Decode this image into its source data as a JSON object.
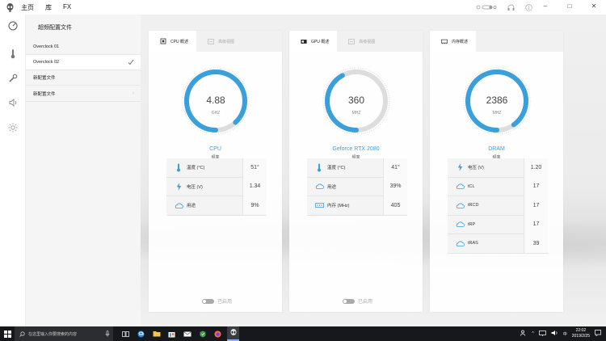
{
  "titlebar": {
    "nav": [
      "主页",
      "库",
      "FX"
    ],
    "tools": [
      "display-toggle-icon",
      "headset-icon",
      "info-icon"
    ],
    "window_controls": [
      "minimize",
      "maximize",
      "close"
    ]
  },
  "rail": {
    "items": [
      "overclock-icon",
      "thermometer-icon",
      "wrench-icon",
      "speaker-icon",
      "brightness-icon"
    ]
  },
  "profiles": {
    "title": "超频配置文件",
    "items": [
      {
        "label": "Overclock 01",
        "selected": false
      },
      {
        "label": "Overclock 02",
        "selected": true
      },
      {
        "label": "新配置文件",
        "selected": false
      },
      {
        "label": "新配置文件",
        "selected": false,
        "has_chevron": true
      }
    ]
  },
  "cards": [
    {
      "tabs": [
        "CPU 概述",
        "高级视图"
      ],
      "tab_icons": [
        "cpu-chip-icon",
        "advanced-view-icon"
      ],
      "gauge": {
        "value": "4.88",
        "unit": "GHZ",
        "fill": 0.88
      },
      "name": "CPU",
      "sub": "频率",
      "stats": [
        {
          "icon": "thermometer-icon",
          "label": "温度 (°C)",
          "value": "51°"
        },
        {
          "icon": "lightning-icon",
          "label": "电压 (V)",
          "value": "1.34"
        },
        {
          "icon": "cloud-icon",
          "label": "用途",
          "value": "9%"
        }
      ],
      "toggle_label": "已启用"
    },
    {
      "tabs": [
        "GPU 概述",
        "高级视图"
      ],
      "tab_icons": [
        "gpu-card-icon",
        "advanced-view-icon"
      ],
      "gauge": {
        "value": "360",
        "unit": "MHZ",
        "fill": 0.42
      },
      "name": "Geforce RTX 2080",
      "sub": "频率",
      "stats": [
        {
          "icon": "thermometer-icon",
          "label": "温度 (°C)",
          "value": "41°"
        },
        {
          "icon": "cloud-icon",
          "label": "用途",
          "value": "39%"
        },
        {
          "icon": "memory-icon",
          "label": "内存 (MHz)",
          "value": "405"
        }
      ],
      "toggle_label": "已启用"
    },
    {
      "tabs": [
        "内存概述"
      ],
      "tab_icons": [
        "memory-module-icon"
      ],
      "gauge": {
        "value": "2386",
        "unit": "MHZ",
        "fill": 0.9
      },
      "name": "DRAM",
      "sub": "频率",
      "stats": [
        {
          "icon": "lightning-icon",
          "label": "电压 (V)",
          "value": "1.20"
        },
        {
          "icon": "cloud-icon",
          "label": "tCL",
          "value": "17"
        },
        {
          "icon": "cloud-icon",
          "label": "tRCD",
          "value": "17"
        },
        {
          "icon": "cloud-icon",
          "label": "tRP",
          "value": "17"
        },
        {
          "icon": "cloud-icon",
          "label": "tRAS",
          "value": "39"
        }
      ]
    }
  ],
  "colors": {
    "accent": "#3aa0dc",
    "gauge_track": "#dddddd"
  },
  "taskbar": {
    "search_placeholder": "在这里输入你要搜索的内容",
    "apps": [
      "task-view-icon",
      "edge-icon",
      "file-explorer-icon",
      "store-icon",
      "mail-icon",
      "security-icon",
      "firefox-icon",
      "alienware-icon"
    ],
    "time": "22:02",
    "date": "2019/2/25"
  }
}
